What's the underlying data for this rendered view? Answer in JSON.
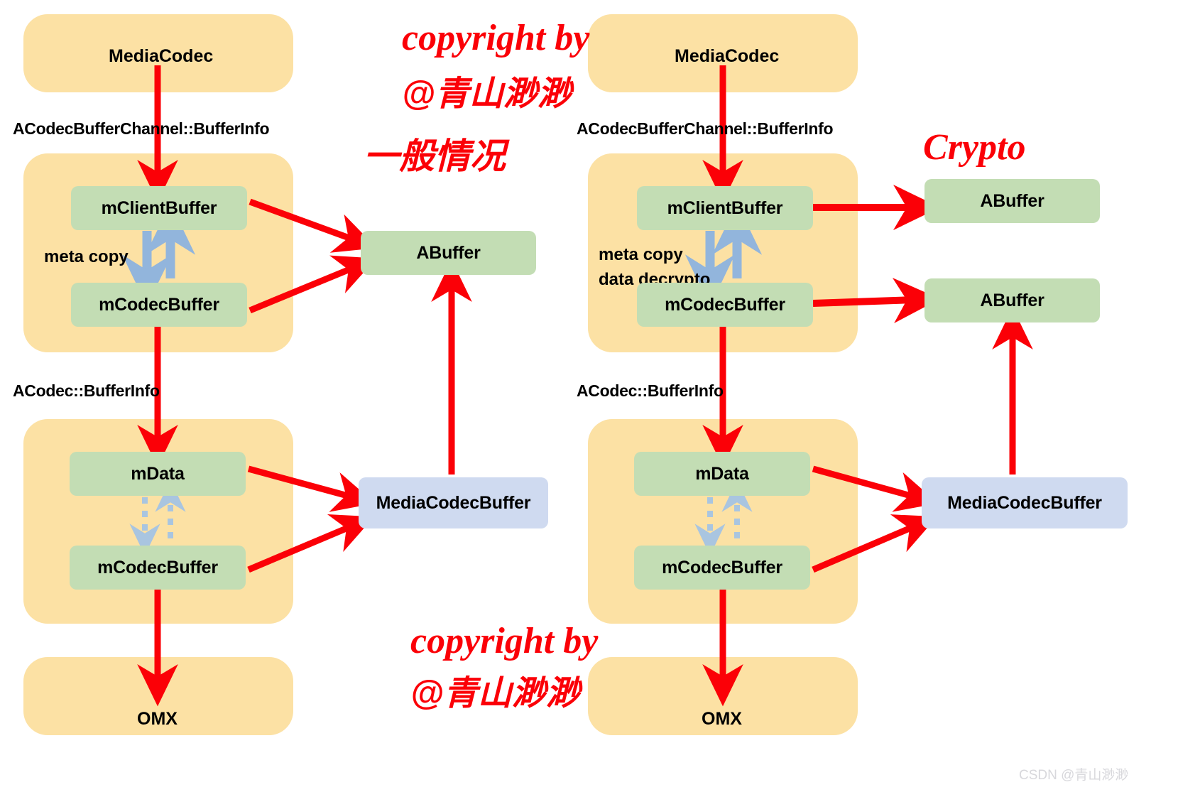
{
  "diagram": {
    "title_left_annotation": "一般情况",
    "title_right_annotation": "Crypto",
    "copyright_line1": "copyright by",
    "copyright_line2": "@青山渺渺",
    "watermark": "CSDN @青山渺渺",
    "colors": {
      "group_yellow": "#fce1a4",
      "node_green": "#c3ddb4",
      "node_blue": "#cfdaf0",
      "arrow_red": "#fb0007",
      "arrow_blue": "#92b5dc",
      "red_text": "#fb0007",
      "watermark_grey": "#d8d8dc"
    }
  },
  "left_panel": {
    "media_codec": "MediaCodec",
    "type_label_top": "ACodecBufferChannel::BufferInfo",
    "type_label_bottom": "ACodec::BufferInfo",
    "client_buffer": "mClientBuffer",
    "codec_buffer_top": "mCodecBuffer",
    "meta_copy": "meta copy",
    "abuffer": "ABuffer",
    "m_data": "mData",
    "codec_buffer_bottom": "mCodecBuffer",
    "media_codec_buffer": "MediaCodecBuffer",
    "omx": "OMX"
  },
  "right_panel": {
    "media_codec": "MediaCodec",
    "type_label_top": "ACodecBufferChannel::BufferInfo",
    "type_label_bottom": "ACodec::BufferInfo",
    "client_buffer": "mClientBuffer",
    "codec_buffer_top": "mCodecBuffer",
    "meta_copy": "meta copy",
    "data_decrypto": "data decrypto",
    "abuffer_top": "ABuffer",
    "abuffer_bottom": "ABuffer",
    "m_data": "mData",
    "codec_buffer_bottom": "mCodecBuffer",
    "media_codec_buffer": "MediaCodecBuffer",
    "omx": "OMX"
  }
}
